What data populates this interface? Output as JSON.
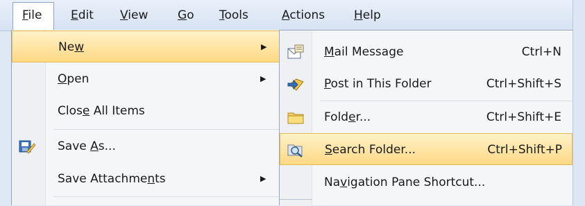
{
  "menubar": {
    "items": [
      {
        "label": "File",
        "accel_index": 0
      },
      {
        "label": "Edit",
        "accel_index": 0
      },
      {
        "label": "View",
        "accel_index": 0
      },
      {
        "label": "Go",
        "accel_index": 0
      },
      {
        "label": "Tools",
        "accel_index": 0
      },
      {
        "label": "Actions",
        "accel_index": 0
      },
      {
        "label": "Help",
        "accel_index": 0
      }
    ]
  },
  "file_menu": {
    "items": [
      {
        "label": "New",
        "accel_index": 2,
        "submenu": true,
        "highlighted": true,
        "icon": "none"
      },
      {
        "label": "Open",
        "accel_index": 0,
        "submenu": true,
        "highlighted": false,
        "icon": "none"
      },
      {
        "label": "Close All Items",
        "accel_index": 4,
        "submenu": false,
        "highlighted": false,
        "icon": "none"
      },
      {
        "label": "Save As...",
        "accel_index": 5,
        "submenu": false,
        "highlighted": false,
        "icon": "save-as-icon"
      },
      {
        "label": "Save Attachments",
        "accel_index": 13,
        "submenu": true,
        "highlighted": false,
        "icon": "none"
      }
    ]
  },
  "new_submenu": {
    "items": [
      {
        "label": "Mail Message",
        "accel_index": 0,
        "shortcut": "Ctrl+N",
        "highlighted": false,
        "icon": "mail-message-icon"
      },
      {
        "label": "Post in This Folder",
        "accel_index": 0,
        "shortcut": "Ctrl+Shift+S",
        "highlighted": false,
        "icon": "post-icon"
      },
      {
        "label": "Folder...",
        "accel_index": 4,
        "shortcut": "Ctrl+Shift+E",
        "highlighted": false,
        "icon": "folder-icon"
      },
      {
        "label": "Search Folder...",
        "accel_index": 0,
        "shortcut": "Ctrl+Shift+P",
        "highlighted": true,
        "icon": "search-folder-icon"
      },
      {
        "label": "Navigation Pane Shortcut...",
        "accel_index": 2,
        "shortcut": "",
        "highlighted": false,
        "icon": "none"
      }
    ]
  },
  "colors": {
    "highlight": "#ffd985",
    "highlight_border": "#e8b94e",
    "menubar_bg": "#dfe8f5"
  }
}
